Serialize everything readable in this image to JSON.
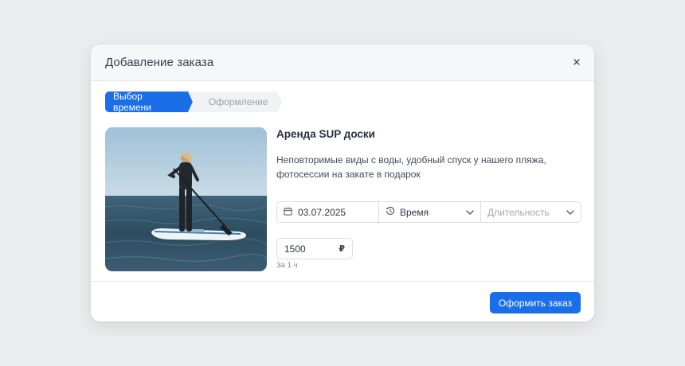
{
  "modal": {
    "title": "Добавление заказа",
    "close_icon": "close-icon"
  },
  "steps": [
    {
      "label": "Выбор времени",
      "active": true
    },
    {
      "label": "Оформление",
      "active": false
    }
  ],
  "product": {
    "image": "paddleboard-photo",
    "title": "Аренда SUP доски",
    "description": "Неповторимые виды с воды, удобный спуск у нашего пляжа, фотосессии на закате в подарок"
  },
  "booking": {
    "date_value": "03.07.2025",
    "date_icon": "calendar-icon",
    "time_placeholder": "Время",
    "time_icon": "clock-icon",
    "duration_placeholder": "Длительность",
    "price_value": "1500",
    "currency": "₽",
    "price_note": "За 1 ч"
  },
  "actions": {
    "submit_label": "Оформить заказ"
  },
  "colors": {
    "accent": "#1a6ee8",
    "background": "#ebeced"
  }
}
